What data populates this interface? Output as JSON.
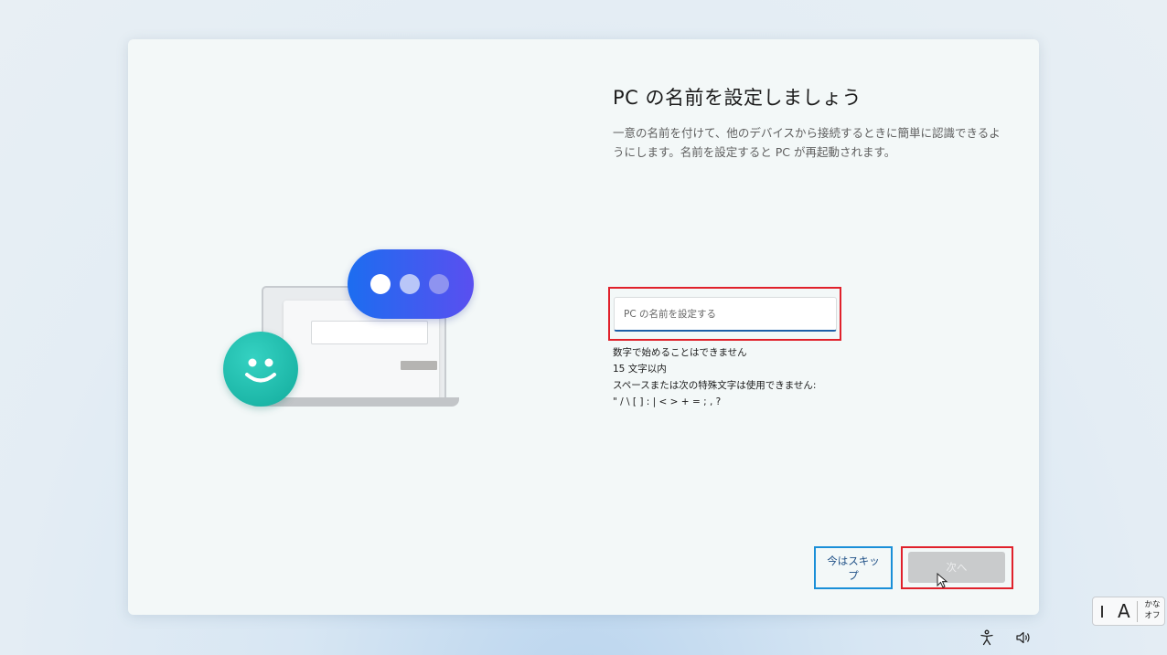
{
  "setup": {
    "title": "PC の名前を設定しましょう",
    "description": "一意の名前を付けて、他のデバイスから接続するときに簡単に認識できるようにします。名前を設定すると PC が再起動されます。",
    "name_input": {
      "value": "",
      "placeholder": "PC の名前を設定する"
    },
    "rules": [
      "数字で始めることはできません",
      "15 文字以内",
      "スペースまたは次の特殊文字は使用できません:",
      "\" / \\ [ ] : | < > + = ; , ?"
    ],
    "skip_label": "今はスキップ",
    "next_label": "次へ"
  },
  "ime": {
    "mode_char": "A",
    "kana_label": "かな\nオフ"
  },
  "icons": [
    "accessibility-icon",
    "volume-icon",
    "smiley-icon",
    "chat-bubble-icon",
    "laptop-icon",
    "mouse-cursor-icon"
  ],
  "colors": {
    "accent": "#1e5fa8",
    "highlight_red": "#e0212b",
    "highlight_blue": "#1a8fd8",
    "bubble": "#1c6df0",
    "smile": "#12ab9c"
  }
}
